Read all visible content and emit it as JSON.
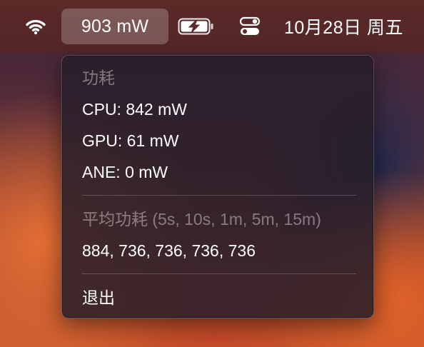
{
  "menubar": {
    "wifi_icon": "wifi-icon",
    "power_label": "903 mW",
    "battery_icon": "battery-charging-icon",
    "control_center_icon": "control-center-icon",
    "datetime": "10月28日 周五"
  },
  "menu": {
    "header": "功耗",
    "cpu": "CPU: 842 mW",
    "gpu": "GPU: 61 mW",
    "ane": "ANE: 0 mW",
    "avg_header": "平均功耗 (5s, 10s, 1m, 5m, 15m)",
    "avg_values": "884, 736, 736, 736, 736",
    "quit": "退出"
  },
  "colors": {
    "menubar": "#5a2a28",
    "menu_background": "#281e2a",
    "text": "#ffffff"
  }
}
